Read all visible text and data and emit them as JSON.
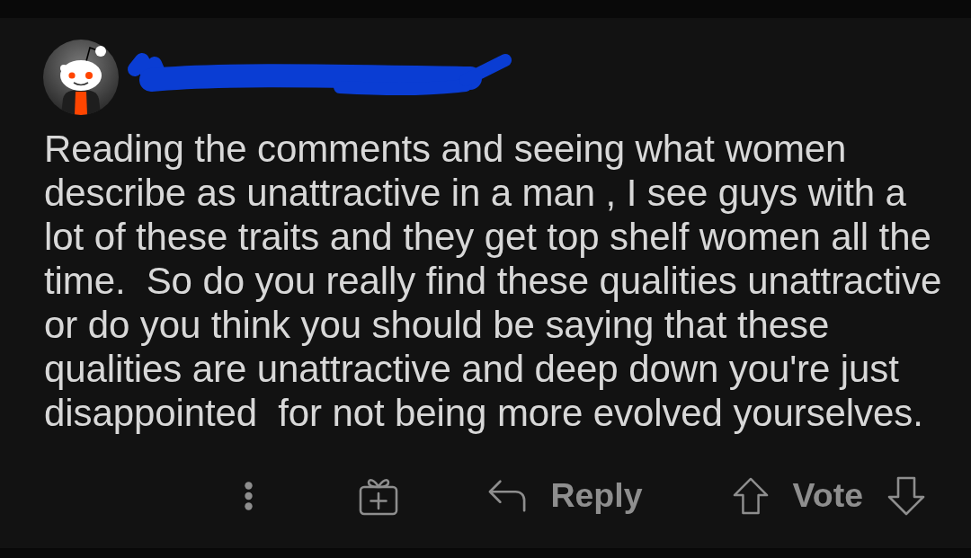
{
  "comment": {
    "body": "Reading the comments and seeing what women\ndescribe as unattractive in a man , I see guys with a\nlot of these traits and they get top shelf women all the\ntime.  So do you really find these qualities unattractive\nor do you think you should be saying that these\nqualities are unattractive and deep down you're just\ndisappointed  for not being more evolved yourselves."
  },
  "actions": [
    {
      "kind": "more"
    },
    {
      "kind": "award"
    },
    {
      "kind": "reply",
      "label": "Reply"
    },
    {
      "kind": "vote",
      "label": "Vote"
    }
  ]
}
